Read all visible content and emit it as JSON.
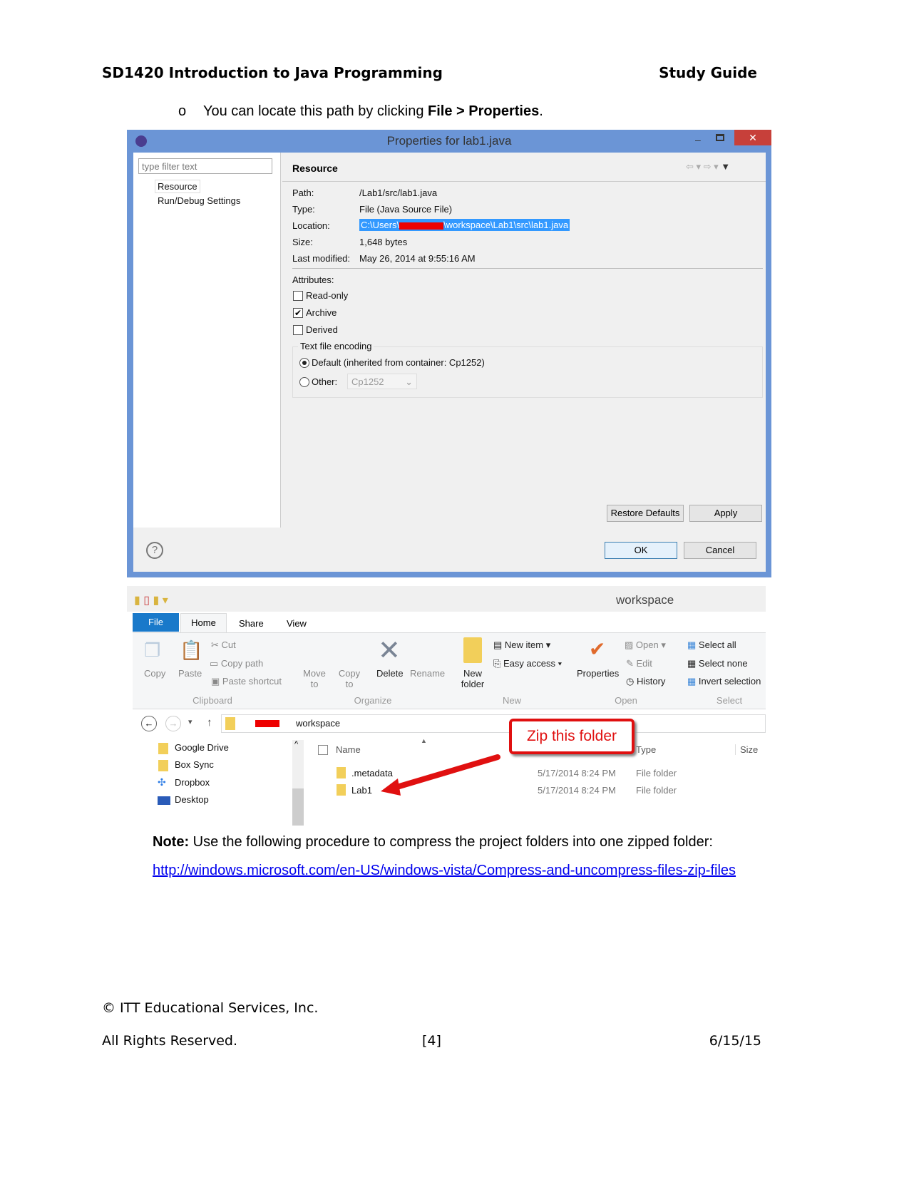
{
  "header": {
    "left": "SD1420 Introduction to Java Programming",
    "right": "Study Guide"
  },
  "bullet": {
    "marker": "o",
    "text_pre": "You can locate this path by clicking ",
    "bold": "File > Properties",
    "text_post": "."
  },
  "dialog": {
    "title": "Properties for lab1.java",
    "filter_placeholder": "type filter text",
    "tree": [
      "Resource",
      "Run/Debug Settings"
    ],
    "section": "Resource",
    "fields": [
      {
        "label": "Path:",
        "value": "/Lab1/src/lab1.java"
      },
      {
        "label": "Type:",
        "value": "File  (Java Source File)"
      },
      {
        "label": "Location:",
        "value_pre": "C:\\Users\\",
        "value_post": "\\workspace\\Lab1\\src\\lab1.java"
      },
      {
        "label": "Size:",
        "value": "1,648  bytes"
      },
      {
        "label": "Last modified:",
        "value": "May 26, 2014 at 9:55:16 AM"
      }
    ],
    "attributes_label": "Attributes:",
    "checkboxes": [
      {
        "label": "Read-only",
        "checked": false
      },
      {
        "label": "Archive",
        "checked": true
      },
      {
        "label": "Derived",
        "checked": false
      }
    ],
    "encoding_label": "Text file encoding",
    "radio_default": "Default (inherited from container: Cp1252)",
    "radio_other": "Other:",
    "other_value": "Cp1252",
    "restore_defaults": "Restore Defaults",
    "apply": "Apply",
    "ok": "OK",
    "cancel": "Cancel",
    "accent": "#6b95d6"
  },
  "explorer": {
    "title": "workspace",
    "tabs": [
      "File",
      "Home",
      "Share",
      "View"
    ],
    "ribbon": {
      "copy": "Copy",
      "paste": "Paste",
      "cut": "Cut",
      "copy_path": "Copy path",
      "paste_shortcut": "Paste shortcut",
      "move_to": "Move to",
      "copy_to": "Copy to",
      "delete": "Delete",
      "rename": "Rename",
      "new_folder": "New folder",
      "new_item": "New item",
      "easy_access": "Easy access",
      "properties": "Properties",
      "open": "Open",
      "edit": "Edit",
      "history": "History",
      "select_all": "Select all",
      "select_none": "Select none",
      "invert_selection": "Invert selection",
      "groups": [
        "Clipboard",
        "Organize",
        "New",
        "Open",
        "Select"
      ]
    },
    "breadcrumb": "workspace",
    "nav": [
      "Google Drive",
      "Box Sync",
      "Dropbox",
      "Desktop"
    ],
    "columns": [
      "Name",
      "Type",
      "Size"
    ],
    "rows": [
      {
        "name": ".metadata",
        "date": "5/17/2014 8:24 PM",
        "type": "File folder"
      },
      {
        "name": "Lab1",
        "date": "5/17/2014 8:24 PM",
        "type": "File folder"
      }
    ],
    "callout": "Zip this folder"
  },
  "note": {
    "bold": "Note:",
    "text": " Use the following procedure to compress the project folders into one zipped folder:",
    "link": "http://windows.microsoft.com/en-US/windows-vista/Compress-and-uncompress-files-zip-files"
  },
  "footer": {
    "copyright": "© ITT Educational Services, Inc.",
    "rights": "All Rights Reserved.",
    "page": "[4]",
    "date": "6/15/15"
  }
}
